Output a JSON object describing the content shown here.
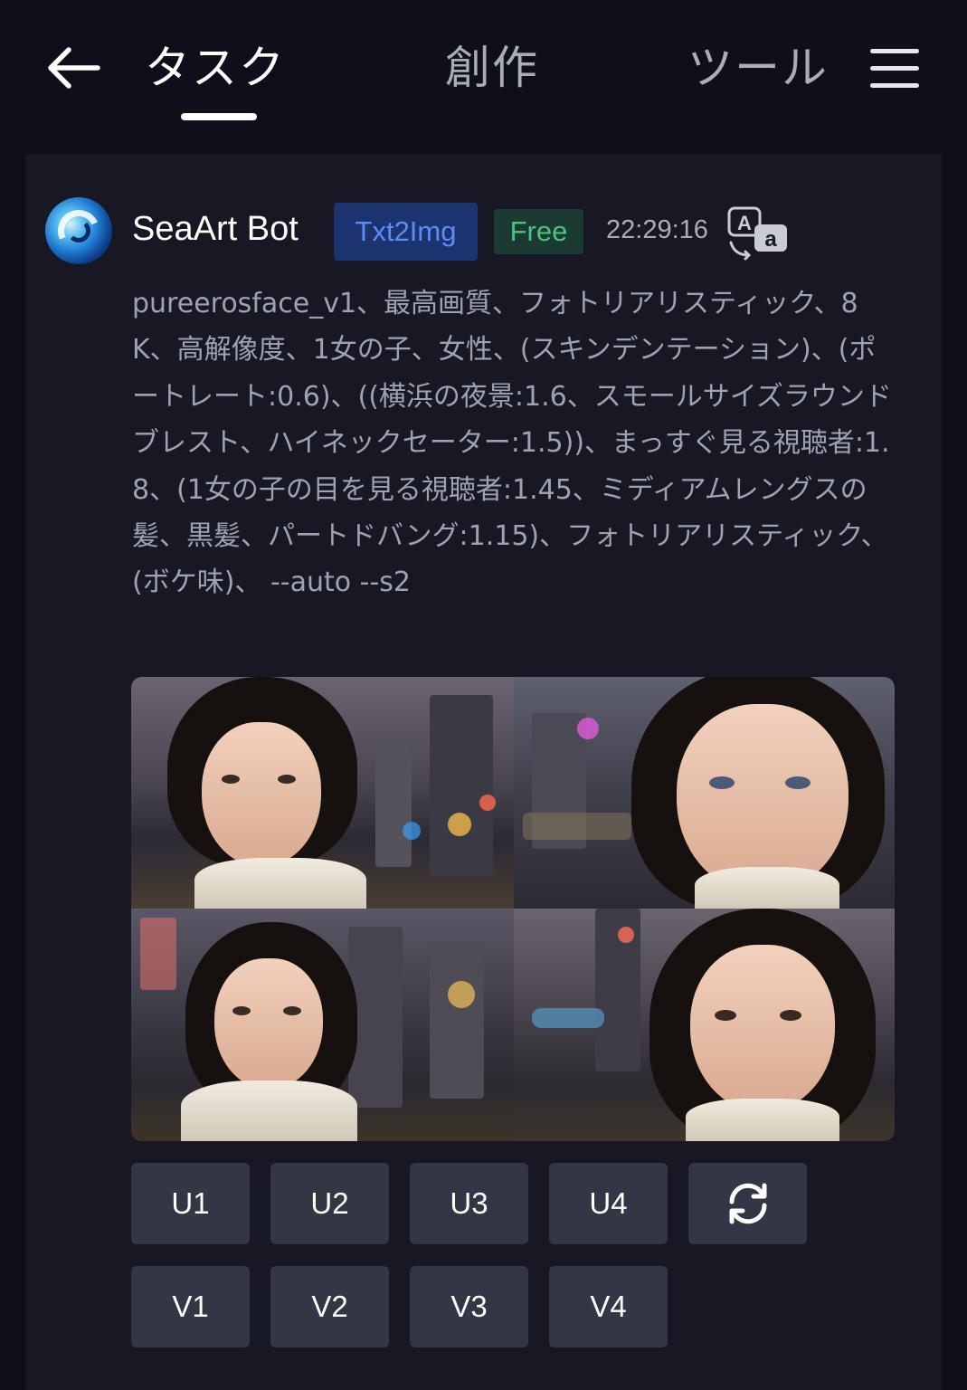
{
  "nav": {
    "tabs": [
      {
        "label": "タスク",
        "active": true
      },
      {
        "label": "創作",
        "active": false
      },
      {
        "label": "ツール",
        "active": false
      }
    ],
    "icons": {
      "back": "arrow-left-icon",
      "menu": "hamburger-menu-icon"
    }
  },
  "message": {
    "bot_name": "SeaArt Bot",
    "tags": {
      "mode": "Txt2Img",
      "plan": "Free"
    },
    "time": "22:29:16",
    "translate_icon": "translate-icon",
    "prompt": "pureerosface_v1、最高画質、フォトリアリスティック、8K、高解像度、1女の子、女性、(スキンデンテーション)、(ポートレート:0.6)、((横浜の夜景:1.6、スモールサイズラウンドブレスト、ハイネックセーター:1.5))、まっすぐ見る視聴者:1.8、(1女の子の目を見る視聴者:1.45、ミディアムレングスの髪、黒髪、パートドバング:1.15)、フォトリアリスティック、(ボケ味)、 --auto --s2"
  },
  "actions": {
    "upscale": [
      "U1",
      "U2",
      "U3",
      "U4"
    ],
    "variation": [
      "V1",
      "V2",
      "V3",
      "V4"
    ],
    "reroll_icon": "refresh-icon"
  },
  "colors": {
    "background": "#0e0f1a",
    "card": "#171824",
    "button": "#333645",
    "tag_txt_bg": "#1b3470",
    "tag_txt_fg": "#5b8ef0",
    "tag_free_bg": "#1b3a32",
    "tag_free_fg": "#4cc27f"
  }
}
